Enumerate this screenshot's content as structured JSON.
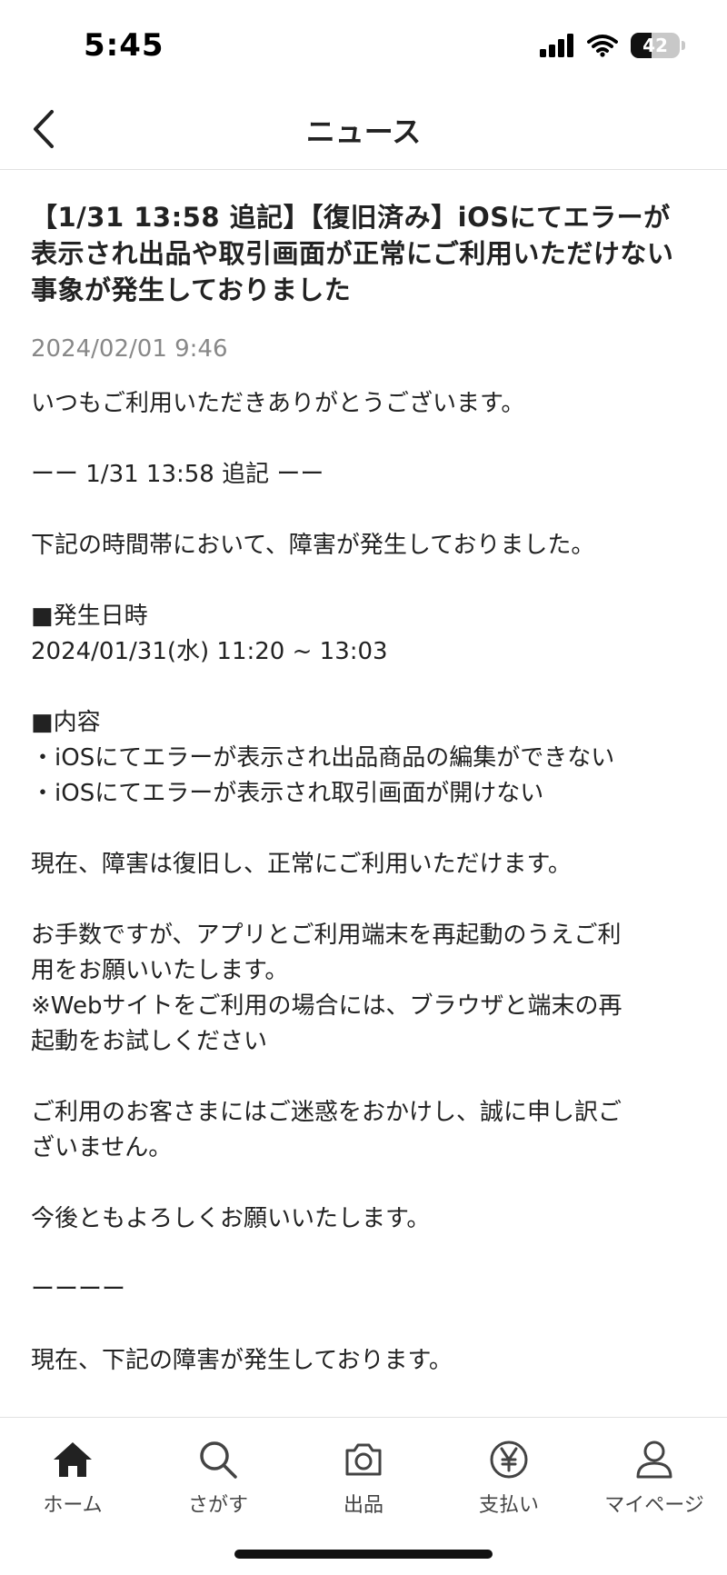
{
  "status_bar": {
    "time": "5:45",
    "battery": "42"
  },
  "nav": {
    "title": "ニュース"
  },
  "article": {
    "title": "【1/31 13:58 追記】【復旧済み】iOSにてエラーが表示され出品や取引画面が正常にご利用いただけない事象が発生しておりました",
    "date": "2024/02/01 9:46",
    "body": [
      "いつもご利用いただきありがとうございます。",
      "",
      "ーー 1/31 13:58 追記 ーー",
      "",
      "下記の時間帯において、障害が発生しておりました。",
      "",
      "■発生日時",
      "2024/01/31(水) 11:20 ~ 13:03",
      "",
      "■内容",
      "・iOSにてエラーが表示され出品商品の編集ができない",
      "・iOSにてエラーが表示され取引画面が開けない",
      "",
      "現在、障害は復旧し、正常にご利用いただけます。",
      "",
      "お手数ですが、アプリとご利用端末を再起動のうえご利",
      "用をお願いいたします。",
      "※Webサイトをご利用の場合には、ブラウザと端末の再",
      "起動をお試しください",
      "",
      "ご利用のお客さまにはご迷惑をおかけし、誠に申し訳ご",
      "ざいません。",
      "",
      "今後ともよろしくお願いいたします。",
      "",
      "ーーーー",
      "",
      "現在、下記の障害が発生しております。"
    ]
  },
  "tabs": [
    {
      "label": "ホーム",
      "icon": "home-icon"
    },
    {
      "label": "さがす",
      "icon": "search-icon"
    },
    {
      "label": "出品",
      "icon": "camera-icon"
    },
    {
      "label": "支払い",
      "icon": "yen-icon"
    },
    {
      "label": "マイページ",
      "icon": "person-icon"
    }
  ],
  "colors": {
    "text": "#222222",
    "muted": "#888888",
    "divider": "#e2e2e2"
  }
}
